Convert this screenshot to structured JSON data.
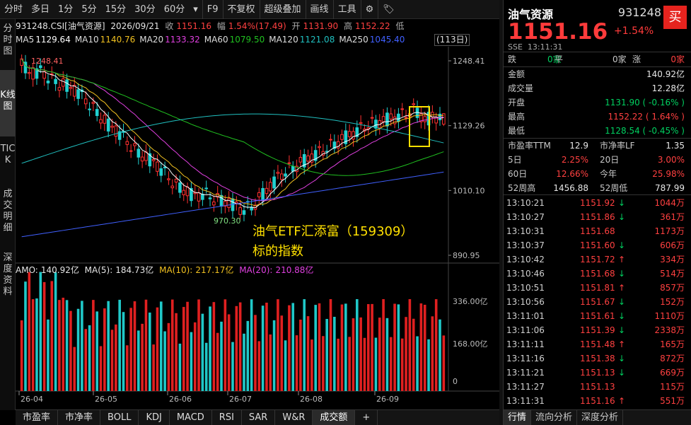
{
  "toolbar": {
    "items": [
      "分时",
      "多日",
      "1分",
      "5分",
      "15分",
      "30分",
      "60分",
      "▾",
      "F9",
      "不复权",
      "超级叠加",
      "画线",
      "工具",
      "⚙",
      "🏷"
    ]
  },
  "side_tabs": [
    "分时图",
    "K线图",
    "TICK",
    "成交明细",
    "深度资料"
  ],
  "info": {
    "code": "931248.CSI[油气资源]",
    "date": "2026/09/21",
    "close_label": "收",
    "close": "1151.16",
    "chg_label": "幅",
    "chg": "1.54%(17.49)",
    "open_label": "开",
    "open": "1131.90",
    "high_label": "高",
    "high": "1152.22",
    "low_label": "低",
    "days": "(113日)"
  },
  "ma": [
    {
      "label": "MA5",
      "value": "1129.64",
      "color": "#ffffff"
    },
    {
      "label": "MA10",
      "value": "1140.76",
      "color": "#f0c020"
    },
    {
      "label": "MA20",
      "value": "1133.32",
      "color": "#e040e0"
    },
    {
      "label": "MA60",
      "value": "1079.50",
      "color": "#20c020"
    },
    {
      "label": "MA120",
      "value": "1121.08",
      "color": "#20c0c0"
    },
    {
      "label": "MA250",
      "value": "1045.40",
      "color": "#4060ff"
    }
  ],
  "amo": {
    "label": "AMO:",
    "value": "140.92亿",
    "ma5_label": "MA(5):",
    "ma5": "184.73亿",
    "ma10_label": "MA(10):",
    "ma10": "217.17亿",
    "ma20_label": "MA(20):",
    "ma20": "210.88亿"
  },
  "price_axis": [
    "1248.41",
    "1129.26",
    "1010.10",
    "890.95"
  ],
  "vol_axis": [
    "336.00亿",
    "168.00亿",
    "0"
  ],
  "date_axis": [
    "26-04",
    "26-05",
    "26-06",
    "26-07",
    "26-08",
    "26-09"
  ],
  "marks": {
    "high": "1248.41",
    "low": "970.30"
  },
  "annotation": {
    "line1": "油气ETF汇添富（159309）",
    "line2": "标的指数"
  },
  "bottom_tabs": [
    "市盈率",
    "市净率",
    "BOLL",
    "KDJ",
    "MACD",
    "RSI",
    "SAR",
    "W&R",
    "成交额",
    "+"
  ],
  "right": {
    "name": "油气资源",
    "code": "931248",
    "buy": "买",
    "price": "1151.16",
    "pct": "+1.54%",
    "exchange": "SSE",
    "time": "13:11:31",
    "updown": {
      "down_label": "跌",
      "down": "0家",
      "flat_label": "平",
      "flat": "0家",
      "up_label": "涨",
      "up": "0家"
    },
    "stats": [
      {
        "k": "金额",
        "v": "140.92亿",
        "c": "#e6e6e6"
      },
      {
        "k": "成交量",
        "v": "12.28亿",
        "c": "#e6e6e6"
      },
      {
        "k": "开盘",
        "v": "1131.90 ( -0.16% )",
        "c": "#00d060"
      },
      {
        "k": "最高",
        "v": "1152.22 ( 1.64% )",
        "c": "#ff4040"
      },
      {
        "k": "最低",
        "v": "1128.54 ( -0.45% )",
        "c": "#00d060"
      }
    ],
    "fund": [
      {
        "k1": "市盈率TTM",
        "v1": "12.9",
        "c1": "#e6e6e6",
        "k2": "市净率LF",
        "v2": "1.35",
        "c2": "#e6e6e6"
      },
      {
        "k1": "5日",
        "v1": "2.25%",
        "c1": "#ff4040",
        "k2": "20日",
        "v2": "3.00%",
        "c2": "#ff4040"
      },
      {
        "k1": "60日",
        "v1": "12.66%",
        "c1": "#ff4040",
        "k2": "今年",
        "v2": "25.98%",
        "c2": "#ff4040"
      },
      {
        "k1": "52周高",
        "v1": "1456.88",
        "c1": "#e6e6e6",
        "k2": "52周低",
        "v2": "787.99",
        "c2": "#e6e6e6"
      }
    ],
    "ticks": [
      {
        "t": "13:10:21",
        "p": "1151.92",
        "d": "down",
        "v": "1044万"
      },
      {
        "t": "13:10:27",
        "p": "1151.86",
        "d": "down",
        "v": "361万"
      },
      {
        "t": "13:10:31",
        "p": "1151.68",
        "d": "",
        "v": "1173万"
      },
      {
        "t": "13:10:37",
        "p": "1151.60",
        "d": "down",
        "v": "606万"
      },
      {
        "t": "13:10:42",
        "p": "1151.72",
        "d": "up",
        "v": "334万"
      },
      {
        "t": "13:10:46",
        "p": "1151.68",
        "d": "down",
        "v": "514万"
      },
      {
        "t": "13:10:51",
        "p": "1151.81",
        "d": "up",
        "v": "857万"
      },
      {
        "t": "13:10:56",
        "p": "1151.67",
        "d": "down",
        "v": "152万"
      },
      {
        "t": "13:11:01",
        "p": "1151.61",
        "d": "down",
        "v": "1110万"
      },
      {
        "t": "13:11:06",
        "p": "1151.39",
        "d": "down",
        "v": "2338万"
      },
      {
        "t": "13:11:11",
        "p": "1151.48",
        "d": "up",
        "v": "165万"
      },
      {
        "t": "13:11:16",
        "p": "1151.38",
        "d": "down",
        "v": "872万"
      },
      {
        "t": "13:11:21",
        "p": "1151.13",
        "d": "down",
        "v": "669万"
      },
      {
        "t": "13:11:27",
        "p": "1151.13",
        "d": "",
        "v": "115万"
      },
      {
        "t": "13:11:31",
        "p": "1151.16",
        "d": "up",
        "v": "551万"
      }
    ],
    "bottom_tabs": [
      "行情",
      "流向分析",
      "深度分析"
    ]
  },
  "chart_data": {
    "type": "candlestick",
    "price_range": [
      890.95,
      1248.41
    ],
    "y_ticks": [
      1248.41,
      1129.26,
      1010.1,
      890.95
    ],
    "x_labels": [
      "26-04",
      "26-05",
      "26-06",
      "26-07",
      "26-08",
      "26-09"
    ],
    "period_high": 1248.41,
    "period_low": 970.3,
    "last": {
      "open": 1131.9,
      "high": 1152.22,
      "low": 1128.54,
      "close": 1151.16
    },
    "volume_axis": [
      "336.00亿",
      "168.00亿",
      "0"
    ]
  }
}
